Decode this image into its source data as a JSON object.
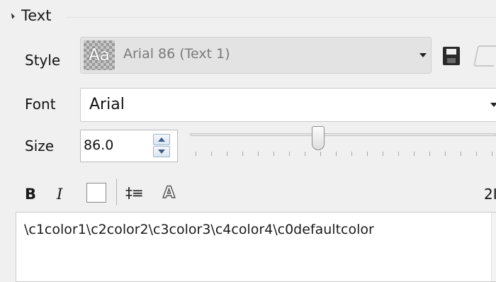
{
  "section": {
    "title": "Text"
  },
  "style": {
    "label": "Style",
    "preview_glyph": "Aa",
    "value": "Arial 86 (Text 1)",
    "icons": [
      "save-icon",
      "eraser-icon"
    ]
  },
  "font": {
    "label": "Font",
    "value": "Arial"
  },
  "size": {
    "label": "Size",
    "value": "86.0",
    "slider_fraction": 0.42
  },
  "toolbar": {
    "bold_label": "B",
    "italic_label": "I",
    "line_spacing_glyph": "‡≡",
    "outline_glyph": "A",
    "right_text": "2I"
  },
  "editor": {
    "text": "\\c1color1\\c2color2\\c3color3\\c4color4\\c0defaultcolor"
  },
  "colors": {
    "panel_bg": "#f0f0f0",
    "style_combo_bg": "#e3e3e3",
    "spin_accent": "#3b5f88"
  }
}
